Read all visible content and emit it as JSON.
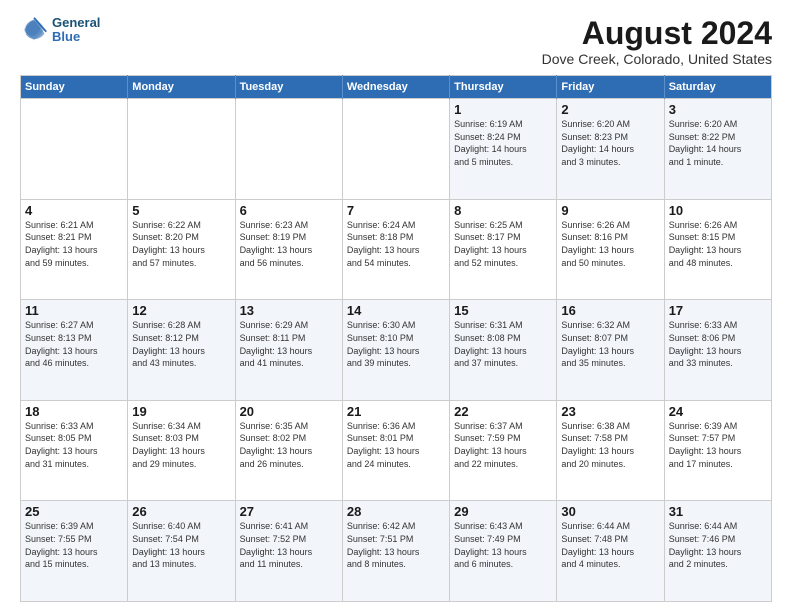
{
  "logo": {
    "line1": "General",
    "line2": "Blue"
  },
  "title": "August 2024",
  "subtitle": "Dove Creek, Colorado, United States",
  "days_of_week": [
    "Sunday",
    "Monday",
    "Tuesday",
    "Wednesday",
    "Thursday",
    "Friday",
    "Saturday"
  ],
  "weeks": [
    [
      {
        "day": "",
        "info": ""
      },
      {
        "day": "",
        "info": ""
      },
      {
        "day": "",
        "info": ""
      },
      {
        "day": "",
        "info": ""
      },
      {
        "day": "1",
        "info": "Sunrise: 6:19 AM\nSunset: 8:24 PM\nDaylight: 14 hours\nand 5 minutes."
      },
      {
        "day": "2",
        "info": "Sunrise: 6:20 AM\nSunset: 8:23 PM\nDaylight: 14 hours\nand 3 minutes."
      },
      {
        "day": "3",
        "info": "Sunrise: 6:20 AM\nSunset: 8:22 PM\nDaylight: 14 hours\nand 1 minute."
      }
    ],
    [
      {
        "day": "4",
        "info": "Sunrise: 6:21 AM\nSunset: 8:21 PM\nDaylight: 13 hours\nand 59 minutes."
      },
      {
        "day": "5",
        "info": "Sunrise: 6:22 AM\nSunset: 8:20 PM\nDaylight: 13 hours\nand 57 minutes."
      },
      {
        "day": "6",
        "info": "Sunrise: 6:23 AM\nSunset: 8:19 PM\nDaylight: 13 hours\nand 56 minutes."
      },
      {
        "day": "7",
        "info": "Sunrise: 6:24 AM\nSunset: 8:18 PM\nDaylight: 13 hours\nand 54 minutes."
      },
      {
        "day": "8",
        "info": "Sunrise: 6:25 AM\nSunset: 8:17 PM\nDaylight: 13 hours\nand 52 minutes."
      },
      {
        "day": "9",
        "info": "Sunrise: 6:26 AM\nSunset: 8:16 PM\nDaylight: 13 hours\nand 50 minutes."
      },
      {
        "day": "10",
        "info": "Sunrise: 6:26 AM\nSunset: 8:15 PM\nDaylight: 13 hours\nand 48 minutes."
      }
    ],
    [
      {
        "day": "11",
        "info": "Sunrise: 6:27 AM\nSunset: 8:13 PM\nDaylight: 13 hours\nand 46 minutes."
      },
      {
        "day": "12",
        "info": "Sunrise: 6:28 AM\nSunset: 8:12 PM\nDaylight: 13 hours\nand 43 minutes."
      },
      {
        "day": "13",
        "info": "Sunrise: 6:29 AM\nSunset: 8:11 PM\nDaylight: 13 hours\nand 41 minutes."
      },
      {
        "day": "14",
        "info": "Sunrise: 6:30 AM\nSunset: 8:10 PM\nDaylight: 13 hours\nand 39 minutes."
      },
      {
        "day": "15",
        "info": "Sunrise: 6:31 AM\nSunset: 8:08 PM\nDaylight: 13 hours\nand 37 minutes."
      },
      {
        "day": "16",
        "info": "Sunrise: 6:32 AM\nSunset: 8:07 PM\nDaylight: 13 hours\nand 35 minutes."
      },
      {
        "day": "17",
        "info": "Sunrise: 6:33 AM\nSunset: 8:06 PM\nDaylight: 13 hours\nand 33 minutes."
      }
    ],
    [
      {
        "day": "18",
        "info": "Sunrise: 6:33 AM\nSunset: 8:05 PM\nDaylight: 13 hours\nand 31 minutes."
      },
      {
        "day": "19",
        "info": "Sunrise: 6:34 AM\nSunset: 8:03 PM\nDaylight: 13 hours\nand 29 minutes."
      },
      {
        "day": "20",
        "info": "Sunrise: 6:35 AM\nSunset: 8:02 PM\nDaylight: 13 hours\nand 26 minutes."
      },
      {
        "day": "21",
        "info": "Sunrise: 6:36 AM\nSunset: 8:01 PM\nDaylight: 13 hours\nand 24 minutes."
      },
      {
        "day": "22",
        "info": "Sunrise: 6:37 AM\nSunset: 7:59 PM\nDaylight: 13 hours\nand 22 minutes."
      },
      {
        "day": "23",
        "info": "Sunrise: 6:38 AM\nSunset: 7:58 PM\nDaylight: 13 hours\nand 20 minutes."
      },
      {
        "day": "24",
        "info": "Sunrise: 6:39 AM\nSunset: 7:57 PM\nDaylight: 13 hours\nand 17 minutes."
      }
    ],
    [
      {
        "day": "25",
        "info": "Sunrise: 6:39 AM\nSunset: 7:55 PM\nDaylight: 13 hours\nand 15 minutes."
      },
      {
        "day": "26",
        "info": "Sunrise: 6:40 AM\nSunset: 7:54 PM\nDaylight: 13 hours\nand 13 minutes."
      },
      {
        "day": "27",
        "info": "Sunrise: 6:41 AM\nSunset: 7:52 PM\nDaylight: 13 hours\nand 11 minutes."
      },
      {
        "day": "28",
        "info": "Sunrise: 6:42 AM\nSunset: 7:51 PM\nDaylight: 13 hours\nand 8 minutes."
      },
      {
        "day": "29",
        "info": "Sunrise: 6:43 AM\nSunset: 7:49 PM\nDaylight: 13 hours\nand 6 minutes."
      },
      {
        "day": "30",
        "info": "Sunrise: 6:44 AM\nSunset: 7:48 PM\nDaylight: 13 hours\nand 4 minutes."
      },
      {
        "day": "31",
        "info": "Sunrise: 6:44 AM\nSunset: 7:46 PM\nDaylight: 13 hours\nand 2 minutes."
      }
    ]
  ]
}
